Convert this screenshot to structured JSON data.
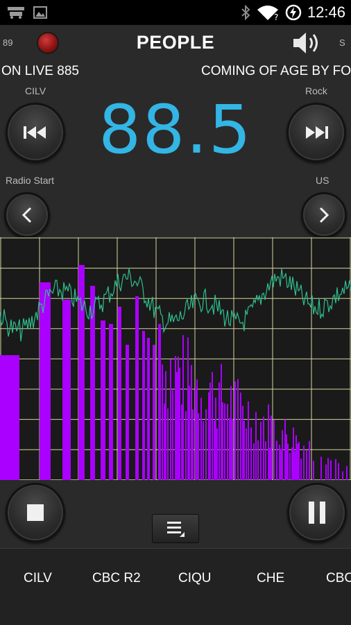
{
  "status": {
    "time": "12:46",
    "icons": [
      "navigation-app-icon",
      "image-icon",
      "bluetooth-icon",
      "wifi-icon",
      "battery-icon"
    ]
  },
  "header": {
    "left_edge": "89",
    "title": "PEOPLE",
    "right_edge": "S"
  },
  "ticker": {
    "left": "ON LIVE 885",
    "right": "COMING OF AGE BY FO"
  },
  "nav": {
    "prev_label": "CILV",
    "next_label": "Rock",
    "frequency": "88.5",
    "prev_genre_label": "Radio Start",
    "next_genre_label": "US"
  },
  "colors": {
    "accent": "#33b5e5",
    "bars": "#aa00ff",
    "wave": "#2fbf8f",
    "grid": "#d6d6a0"
  },
  "stations": [
    "CILV",
    "CBC R2",
    "CIQU",
    "CHE",
    "CBC"
  ]
}
